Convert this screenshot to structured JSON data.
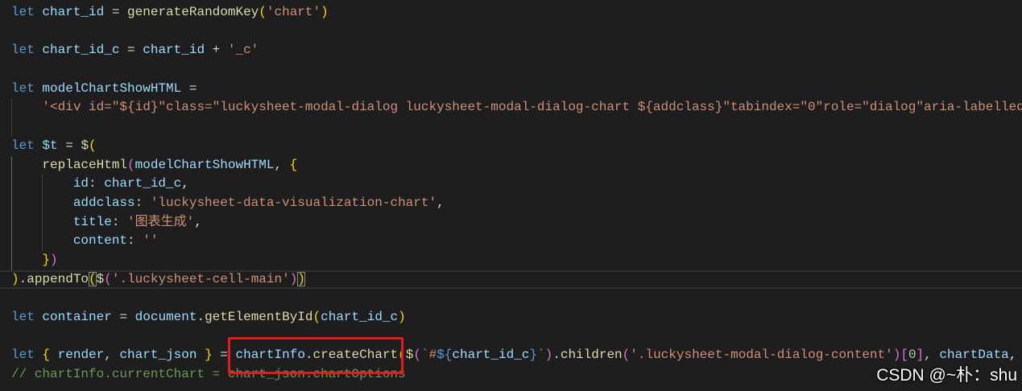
{
  "colors": {
    "background": "#1e1e1e",
    "kw": "#569cd6",
    "var": "#9cdcfe",
    "fn": "#dcdcaa",
    "str": "#ce9178",
    "op": "#d4d4d4",
    "num": "#b5cea8",
    "cmt": "#6a9955",
    "tp": "#569cd6",
    "b1": "#ffd700",
    "b2": "#da70d6",
    "annotation_box": "#e8191c"
  },
  "editor": {
    "active_line": 15,
    "lines": [
      {
        "tokens": [
          {
            "t": "let",
            "k": "kw"
          },
          {
            "t": " ",
            "k": "op"
          },
          {
            "t": "chart_id",
            "k": "var"
          },
          {
            "t": " = ",
            "k": "op"
          },
          {
            "t": "generateRandomKey",
            "k": "fn"
          },
          {
            "t": "(",
            "k": "b1"
          },
          {
            "t": "'chart'",
            "k": "str"
          },
          {
            "t": ")",
            "k": "b1"
          }
        ]
      },
      {
        "tokens": []
      },
      {
        "tokens": [
          {
            "t": "let",
            "k": "kw"
          },
          {
            "t": " ",
            "k": "op"
          },
          {
            "t": "chart_id_c",
            "k": "var"
          },
          {
            "t": " = ",
            "k": "op"
          },
          {
            "t": "chart_id",
            "k": "var"
          },
          {
            "t": " + ",
            "k": "op"
          },
          {
            "t": "'_c'",
            "k": "str"
          }
        ]
      },
      {
        "tokens": []
      },
      {
        "tokens": [
          {
            "t": "let",
            "k": "kw"
          },
          {
            "t": " ",
            "k": "op"
          },
          {
            "t": "modelChartShowHTML",
            "k": "var"
          },
          {
            "t": " =",
            "k": "op"
          }
        ]
      },
      {
        "tokens": [
          {
            "t": "    ",
            "k": "op"
          },
          {
            "t": "'<div id=\"${id}\"class=\"luckysheet-modal-dialog luckysheet-modal-dialog-chart ${addclass}\"tabindex=\"0\"role=\"dialog\"aria-labelled",
            "k": "str"
          }
        ]
      },
      {
        "tokens": []
      },
      {
        "tokens": [
          {
            "t": "let",
            "k": "kw"
          },
          {
            "t": " ",
            "k": "op"
          },
          {
            "t": "$t",
            "k": "var"
          },
          {
            "t": " = ",
            "k": "op"
          },
          {
            "t": "$",
            "k": "fn"
          },
          {
            "t": "(",
            "k": "b1"
          }
        ]
      },
      {
        "tokens": [
          {
            "t": "    ",
            "k": "op"
          },
          {
            "t": "replaceHtml",
            "k": "fn"
          },
          {
            "t": "(",
            "k": "b2"
          },
          {
            "t": "modelChartShowHTML",
            "k": "var"
          },
          {
            "t": ", ",
            "k": "op"
          },
          {
            "t": "{",
            "k": "b1"
          }
        ]
      },
      {
        "tokens": [
          {
            "t": "        ",
            "k": "op"
          },
          {
            "t": "id",
            "k": "var"
          },
          {
            "t": ": ",
            "k": "op"
          },
          {
            "t": "chart_id_c",
            "k": "var"
          },
          {
            "t": ",",
            "k": "op"
          }
        ]
      },
      {
        "tokens": [
          {
            "t": "        ",
            "k": "op"
          },
          {
            "t": "addclass",
            "k": "var"
          },
          {
            "t": ": ",
            "k": "op"
          },
          {
            "t": "'luckysheet-data-visualization-chart'",
            "k": "str"
          },
          {
            "t": ",",
            "k": "op"
          }
        ]
      },
      {
        "tokens": [
          {
            "t": "        ",
            "k": "op"
          },
          {
            "t": "title",
            "k": "var"
          },
          {
            "t": ": ",
            "k": "op"
          },
          {
            "t": "'图表生成'",
            "k": "str"
          },
          {
            "t": ",",
            "k": "op"
          }
        ]
      },
      {
        "tokens": [
          {
            "t": "        ",
            "k": "op"
          },
          {
            "t": "content",
            "k": "var"
          },
          {
            "t": ": ",
            "k": "op"
          },
          {
            "t": "''",
            "k": "str"
          }
        ]
      },
      {
        "tokens": [
          {
            "t": "    ",
            "k": "op"
          },
          {
            "t": "}",
            "k": "b1"
          },
          {
            "t": ")",
            "k": "b2"
          }
        ]
      },
      {
        "tokens": [
          {
            "t": ")",
            "k": "b1"
          },
          {
            "t": ".",
            "k": "op"
          },
          {
            "t": "appendTo",
            "k": "fn"
          },
          {
            "t": "(",
            "k": "b1",
            "match": true
          },
          {
            "t": "$",
            "k": "fn"
          },
          {
            "t": "(",
            "k": "b2"
          },
          {
            "t": "'.luckysheet-cell-main'",
            "k": "str"
          },
          {
            "t": ")",
            "k": "b2"
          },
          {
            "t": ")",
            "k": "b1",
            "match": true
          }
        ]
      },
      {
        "tokens": []
      },
      {
        "tokens": [
          {
            "t": "let",
            "k": "kw"
          },
          {
            "t": " ",
            "k": "op"
          },
          {
            "t": "container",
            "k": "var"
          },
          {
            "t": " = ",
            "k": "op"
          },
          {
            "t": "document",
            "k": "var"
          },
          {
            "t": ".",
            "k": "op"
          },
          {
            "t": "getElementById",
            "k": "fn"
          },
          {
            "t": "(",
            "k": "b1"
          },
          {
            "t": "chart_id_c",
            "k": "var"
          },
          {
            "t": ")",
            "k": "b1"
          }
        ]
      },
      {
        "tokens": []
      },
      {
        "tokens": [
          {
            "t": "let",
            "k": "kw"
          },
          {
            "t": " ",
            "k": "op"
          },
          {
            "t": "{",
            "k": "b1"
          },
          {
            "t": " ",
            "k": "op"
          },
          {
            "t": "render",
            "k": "var"
          },
          {
            "t": ", ",
            "k": "op"
          },
          {
            "t": "chart_json",
            "k": "var"
          },
          {
            "t": " ",
            "k": "op"
          },
          {
            "t": "}",
            "k": "b1"
          },
          {
            "t": " = ",
            "k": "op"
          },
          {
            "t": "chartInfo",
            "k": "var"
          },
          {
            "t": ".",
            "k": "op"
          },
          {
            "t": "createChart",
            "k": "fn"
          },
          {
            "t": "(",
            "k": "b1"
          },
          {
            "t": "$",
            "k": "fn"
          },
          {
            "t": "(",
            "k": "b2"
          },
          {
            "t": "`#",
            "k": "str"
          },
          {
            "t": "${",
            "k": "tp"
          },
          {
            "t": "chart_id_c",
            "k": "var"
          },
          {
            "t": "}",
            "k": "tp"
          },
          {
            "t": "`",
            "k": "str"
          },
          {
            "t": ")",
            "k": "b2"
          },
          {
            "t": ".",
            "k": "op"
          },
          {
            "t": "children",
            "k": "fn"
          },
          {
            "t": "(",
            "k": "b2"
          },
          {
            "t": "'.luckysheet-modal-dialog-content'",
            "k": "str"
          },
          {
            "t": ")",
            "k": "b2"
          },
          {
            "t": "[",
            "k": "b2"
          },
          {
            "t": "0",
            "k": "num"
          },
          {
            "t": "]",
            "k": "b2"
          },
          {
            "t": ", ",
            "k": "op"
          },
          {
            "t": "chartData",
            "k": "var"
          },
          {
            "t": ",",
            "k": "op"
          }
        ]
      },
      {
        "tokens": [
          {
            "t": "// chartInfo.currentChart = chart_json.chartOptions",
            "k": "cmt"
          }
        ]
      }
    ]
  },
  "watermark": "CSDN @~朴：shu"
}
